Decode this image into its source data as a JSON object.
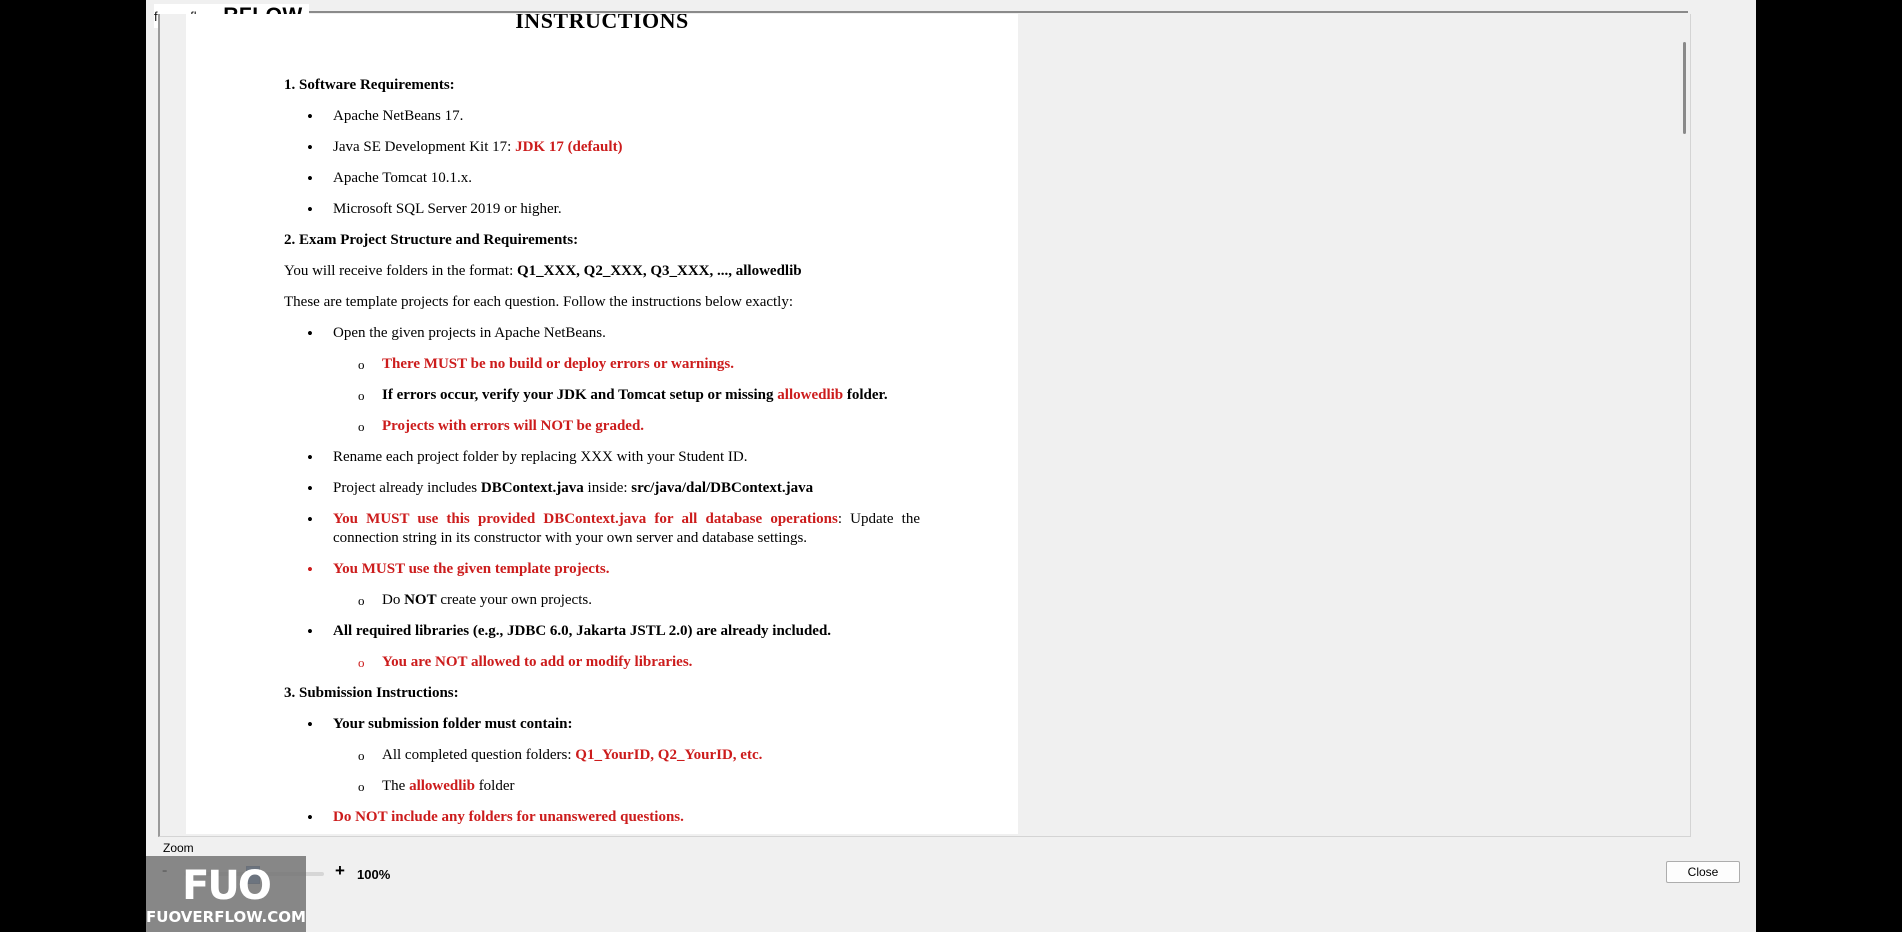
{
  "brand": {
    "small": "fuoverflow",
    "big": "RFLOW"
  },
  "document": {
    "title": "INSTRUCTIONS",
    "sec1": {
      "title": "1. Software Requirements:",
      "items": [
        "Apache NetBeans 17.",
        "Apache Tomcat 10.1.x.",
        "Microsoft SQL Server 2019 or higher."
      ],
      "jdk_prefix": "Java SE Development Kit 17: ",
      "jdk_default": "JDK 17 (default)"
    },
    "sec2": {
      "title": "2. Exam Project Structure and Requirements:",
      "receive_prefix": "You will receive folders in the format: ",
      "receive_format": "Q1_XXX, Q2_XXX, Q3_XXX, ..., allowedlib",
      "template_note": "These are template projects for each question. Follow the instructions below exactly:",
      "open_projects": "Open the given projects in Apache NetBeans.",
      "no_errors": "There MUST be no build or deploy errors or warnings.",
      "verify_prefix": "If errors occur, verify your JDK and Tomcat setup or missing ",
      "verify_folder": "allowedlib",
      "verify_suffix": " folder.",
      "not_graded": "Projects with errors will NOT be graded.",
      "rename": "Rename each project folder by replacing XXX with your Student ID.",
      "includes_prefix": "Project already includes ",
      "includes_file": "DBContext.java",
      "includes_mid": " inside: ",
      "includes_path": "src/java/dal/DBContext.java",
      "must_use": "You MUST use this provided DBContext.java for all database operations",
      "must_use_rest": ": Update the connection string in its constructor with your own server and database settings.",
      "must_template": "You MUST use the given template projects.",
      "do_prefix": "Do ",
      "do_not": "NOT",
      "do_suffix": " create your own projects.",
      "libs": "All required libraries (e.g., JDBC 6.0, Jakarta JSTL 2.0) are already included.",
      "libs_warning": "You are NOT allowed to add or modify libraries."
    },
    "sec3": {
      "title": "3. Submission Instructions:",
      "must_contain": "Your submission folder must contain:",
      "all_prefix": "All completed question folders: ",
      "all_folders": "Q1_YourID, Q2_YourID, etc.",
      "the_prefix": "The ",
      "the_folder": "allowedlib",
      "the_suffix": " folder",
      "no_unanswered": "Do NOT include any folders for unanswered questions."
    }
  },
  "zoom": {
    "label": "Zoom",
    "minus": "-",
    "plus": "+",
    "value": "100%",
    "level_percent": 100
  },
  "watermark": {
    "logo": "FUO",
    "text": "FUOVERFLOW.COM"
  },
  "close_label": "Close",
  "colors": {
    "accent_red": "#cc1c1c",
    "slider_blue": "#1e5fb2"
  }
}
